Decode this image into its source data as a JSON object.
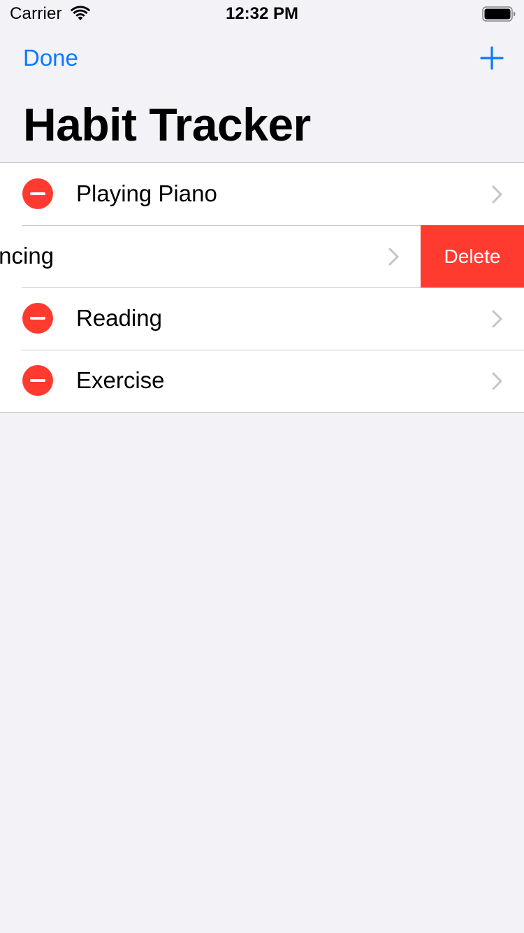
{
  "status_bar": {
    "carrier": "Carrier",
    "time": "12:32 PM"
  },
  "nav": {
    "done_label": "Done",
    "add_icon": "plus-icon",
    "title": "Habit Tracker"
  },
  "colors": {
    "accent": "#0a7aff",
    "destructive": "#ff3b30",
    "background": "#f2f2f7"
  },
  "habits": [
    {
      "label": "Playing Piano"
    },
    {
      "label": "Dancing",
      "visible_text": "ncing",
      "delete_label": "Delete"
    },
    {
      "label": "Reading"
    },
    {
      "label": "Exercise"
    }
  ]
}
